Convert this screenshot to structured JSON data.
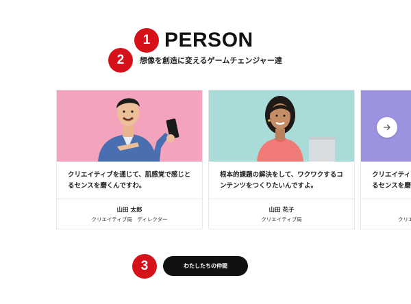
{
  "markers": [
    "1",
    "2",
    "3"
  ],
  "section": {
    "title": "PERSON",
    "subtitle": "想像を創造に変えるゲームチェンジャー達"
  },
  "cards": [
    {
      "description": "クリエイティブを通じて、肌感覚で感じとるセンスを磨くんですわ。",
      "name": "山田 太郎",
      "role": "クリエイティブ局　ディレクター",
      "photo_bg": "#f4a3bd"
    },
    {
      "description": "根本的課題の解決をして、ワクワクするコンテンツをつくりたいんですよ。",
      "name": "山田 花子",
      "role": "クリエイティブ局",
      "photo_bg": "#a9dcd8"
    },
    {
      "description": "クリエイティブを通じて、肌感覚で感じとるセンスを磨くんですわ。",
      "name": "",
      "role": "クリエイティブ局",
      "photo_bg": "#9b93e0"
    }
  ],
  "cta_label": "わたしたちの仲間",
  "colors": {
    "accent": "#d5121a",
    "button": "#111111"
  },
  "icons": {
    "next": "arrow-right-icon"
  }
}
